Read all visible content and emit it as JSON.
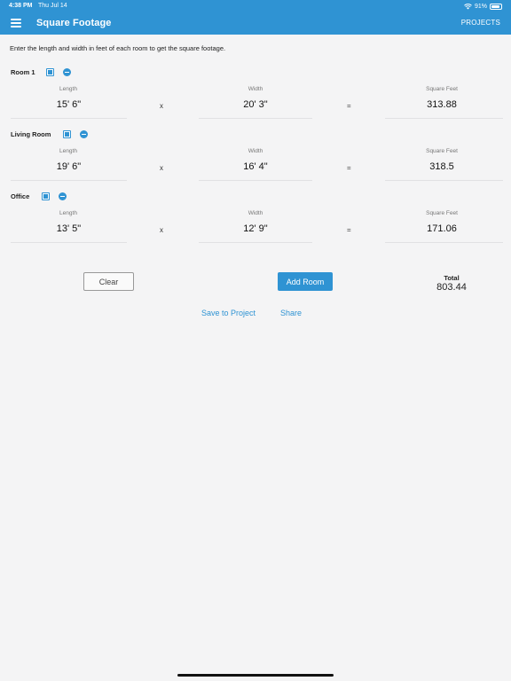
{
  "status_bar": {
    "time": "4:38 PM",
    "date": "Thu Jul 14",
    "battery": "91%",
    "battery_level": 0.91
  },
  "header": {
    "title": "Square Footage",
    "projects_label": "PROJECTS"
  },
  "instructions": "Enter the length and width in feet of each room to get the square footage.",
  "columns": {
    "length": "Length",
    "width": "Width",
    "square_feet": "Square Feet",
    "times": "x",
    "equals": "="
  },
  "rooms": [
    {
      "name": "Room 1",
      "length": "15' 6\"",
      "width": "20' 3\"",
      "square_feet": "313.88"
    },
    {
      "name": "Living Room",
      "length": "19' 6\"",
      "width": "16' 4\"",
      "square_feet": "318.5"
    },
    {
      "name": "Office",
      "length": "13' 5\"",
      "width": "12' 9\"",
      "square_feet": "171.06"
    }
  ],
  "actions": {
    "clear_label": "Clear",
    "add_room_label": "Add Room",
    "save_label": "Save to Project",
    "share_label": "Share"
  },
  "total": {
    "label": "Total",
    "value": "803.44"
  },
  "colors": {
    "accent": "#2f93d3",
    "background": "#f4f4f5"
  },
  "icons": {
    "menu": "hamburger-icon",
    "edit": "edit-icon",
    "remove": "remove-icon",
    "wifi": "wifi-icon",
    "battery": "battery-icon"
  }
}
